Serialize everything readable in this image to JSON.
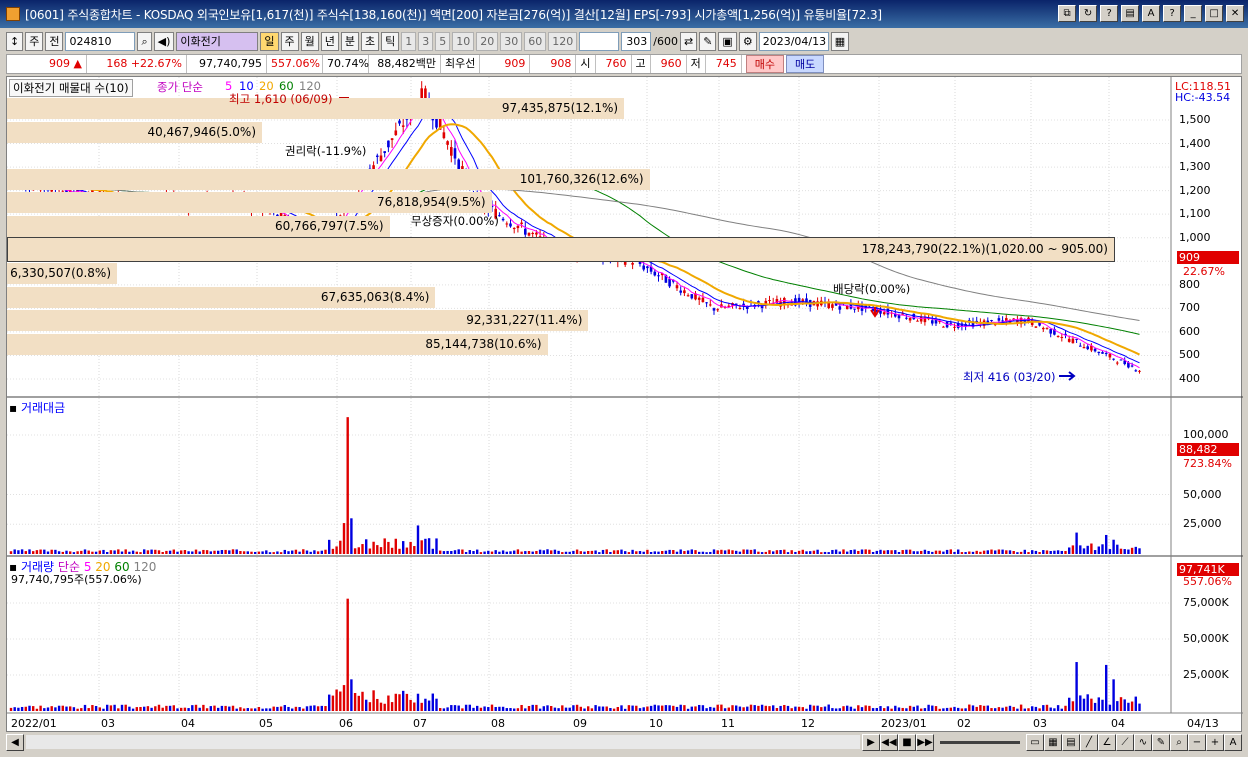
{
  "window": {
    "title": "[0601] 주식종합차트 - KOSDAQ 외국인보유[1,617(천)] 주식수[138,160(천)] 액면[200] 자본금[276(억)] 결산[12월] EPS[-793] 시가총액[1,256(억)] 유통비율[72.3]"
  },
  "toolbar": {
    "market": "주",
    "prev_label": "전",
    "code": "024810",
    "stock_name": "이화전기",
    "period_buttons": [
      "일",
      "주",
      "월",
      "년",
      "분",
      "초",
      "틱"
    ],
    "interval_buttons": [
      "1",
      "3",
      "5",
      "10",
      "20",
      "30",
      "60",
      "120"
    ],
    "count": "303",
    "count_total": "/600",
    "date": "2023/04/13"
  },
  "quote": {
    "price": "909",
    "change": "168",
    "change_pct": "+22.67%",
    "volume": "97,740,795",
    "volume_ratio": "557.06%",
    "turnover_ratio": "70.74%",
    "amount": "88,482백만",
    "best_label": "최우선",
    "bid": "909",
    "ask": "908",
    "open_label": "시",
    "open": "760",
    "high_label": "고",
    "high": "960",
    "low_label": "저",
    "low": "745",
    "buy_label": "매수",
    "sell_label": "매도"
  },
  "price_panel": {
    "title": "이화전기 매물대 수(10)",
    "ma_label": "종가 단순",
    "ma_periods": [
      "5",
      "10",
      "20",
      "60",
      "120"
    ],
    "lc": "LC:118.51",
    "hc": "HC:-43.54",
    "current_price": "909",
    "current_pct": "22.67%",
    "y_ticks": [
      "1,500",
      "1,400",
      "1,300",
      "1,200",
      "1,100",
      "1,000",
      "900",
      "800",
      "700",
      "600",
      "500",
      "400"
    ],
    "annotations": {
      "high": "최고 1,610 (06/09)",
      "low": "최저 416 (03/20)",
      "rights": "권리락(-11.9%)",
      "bonus": "무상증자(0.00%)",
      "dividend": "배당락(0.00%)"
    },
    "volume_profile": [
      {
        "text": "97,435,875(12.1%)",
        "price_from": 1500,
        "price_to": 1600
      },
      {
        "text": "40,467,946(5.0%)",
        "price_from": 1400,
        "price_to": 1500
      },
      {
        "text": "101,760,326(12.6%)",
        "price_from": 1200,
        "price_to": 1300
      },
      {
        "text": "76,818,954(9.5%)",
        "price_from": 1100,
        "price_to": 1200
      },
      {
        "text": "60,766,797(7.5%)",
        "price_from": 1000,
        "price_to": 1100
      },
      {
        "text": "178,243,790(22.1%)(1,020.00 ~ 905.00)",
        "price_from": 905,
        "price_to": 1020
      },
      {
        "text": "6,330,507(0.8%)",
        "price_from": 800,
        "price_to": 900
      },
      {
        "text": "67,635,063(8.4%)",
        "price_from": 700,
        "price_to": 800
      },
      {
        "text": "92,331,227(11.4%)",
        "price_from": 600,
        "price_to": 700
      },
      {
        "text": "85,144,738(10.6%)",
        "price_from": 500,
        "price_to": 600
      }
    ]
  },
  "amount_panel": {
    "title": "거래대금",
    "y_ticks": [
      "100,000",
      "50,000",
      "25,000"
    ],
    "current": "88,482",
    "current_pct": "723.84%"
  },
  "volume_panel": {
    "title": "거래량",
    "ma_label": "단순",
    "ma_periods": [
      "5",
      "20",
      "60",
      "120"
    ],
    "subtitle": "97,740,795주(557.06%)",
    "y_ticks": [
      "75,000K",
      "50,000K",
      "25,000K"
    ],
    "current": "97,741K",
    "current_pct": "557.06%"
  },
  "x_axis": {
    "ticks": [
      "2022/01",
      "03",
      "04",
      "05",
      "06",
      "07",
      "08",
      "09",
      "10",
      "11",
      "12",
      "2023/01",
      "02",
      "03",
      "04"
    ],
    "right_label": "04/13"
  },
  "colors": {
    "up": "#e00000",
    "down": "#0000e0",
    "ma5": "#ff00ff",
    "ma10": "#0000ff",
    "ma20": "#f0a800",
    "ma60": "#008000",
    "ma120": "#808080",
    "band": "#f2dfc4"
  },
  "chart_data": {
    "type": "candlestick",
    "x_range": [
      "2022/01",
      "2023/04/13"
    ],
    "price_range": [
      400,
      1600
    ],
    "close_series_approx": [
      {
        "date": "2022/01",
        "close": 1250
      },
      {
        "date": "2022/02",
        "close": 1180
      },
      {
        "date": "2022/03",
        "close": 1150
      },
      {
        "date": "2022/04",
        "close": 1160
      },
      {
        "date": "2022/05",
        "close": 1000
      },
      {
        "date": "2022/06/09",
        "close": 1610
      },
      {
        "date": "2022/07",
        "close": 1150
      },
      {
        "date": "2022/08",
        "close": 950
      },
      {
        "date": "2022/09",
        "close": 900
      },
      {
        "date": "2022/10",
        "close": 700
      },
      {
        "date": "2022/11",
        "close": 730
      },
      {
        "date": "2022/12",
        "close": 700
      },
      {
        "date": "2023/01",
        "close": 630
      },
      {
        "date": "2023/02",
        "close": 650
      },
      {
        "date": "2023/03/20",
        "close": 416
      },
      {
        "date": "2023/04/13",
        "close": 909
      }
    ]
  }
}
